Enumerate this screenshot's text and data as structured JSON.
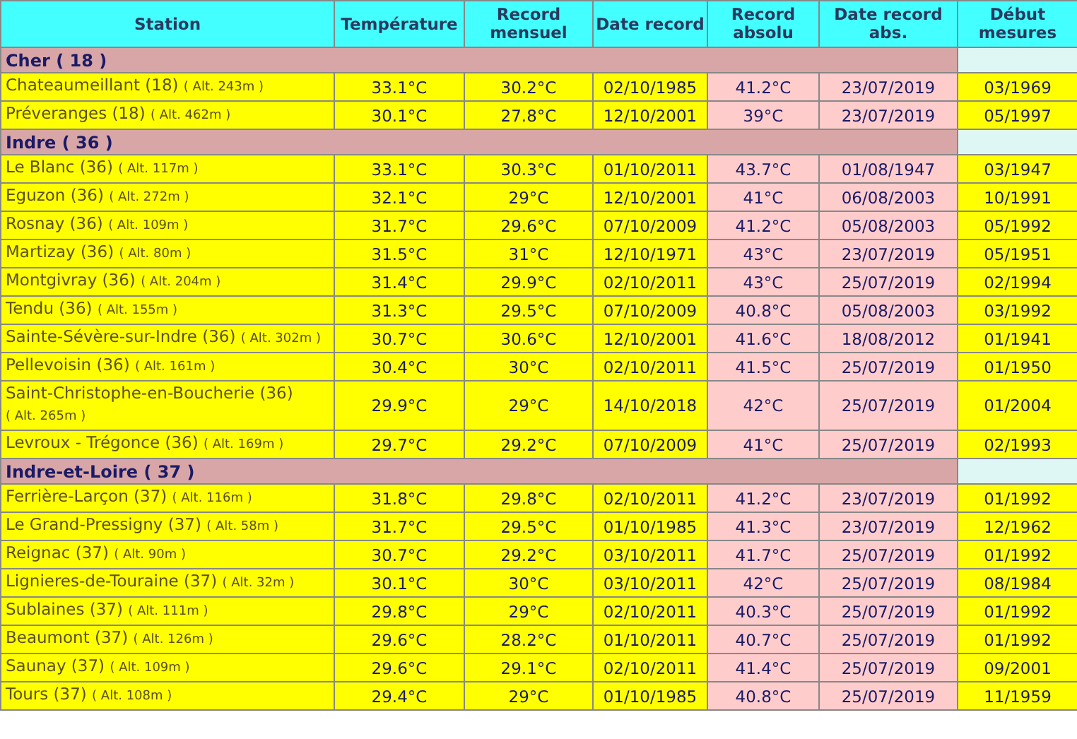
{
  "columns": [
    "Station",
    "Température",
    "Record mensuel",
    "Date record",
    "Record absolu",
    "Date record abs.",
    "Début mesures"
  ],
  "groups": [
    {
      "name": "Cher ( 18 )",
      "rows": [
        {
          "station": "Chateaumeillant (18)",
          "altitude": "( Alt. 243m )",
          "temperature": "33.1°C",
          "record_mensuel": "30.2°C",
          "date_record": "02/10/1985",
          "record_absolu": "41.2°C",
          "date_record_abs": "23/07/2019",
          "debut_mesures": "03/1969"
        },
        {
          "station": "Préveranges (18)",
          "altitude": "( Alt. 462m )",
          "temperature": "30.1°C",
          "record_mensuel": "27.8°C",
          "date_record": "12/10/2001",
          "record_absolu": "39°C",
          "date_record_abs": "23/07/2019",
          "debut_mesures": "05/1997"
        }
      ]
    },
    {
      "name": "Indre ( 36 )",
      "rows": [
        {
          "station": "Le Blanc (36)",
          "altitude": "( Alt. 117m )",
          "temperature": "33.1°C",
          "record_mensuel": "30.3°C",
          "date_record": "01/10/2011",
          "record_absolu": "43.7°C",
          "date_record_abs": "01/08/1947",
          "debut_mesures": "03/1947"
        },
        {
          "station": "Eguzon (36)",
          "altitude": "( Alt. 272m )",
          "temperature": "32.1°C",
          "record_mensuel": "29°C",
          "date_record": "12/10/2001",
          "record_absolu": "41°C",
          "date_record_abs": "06/08/2003",
          "debut_mesures": "10/1991"
        },
        {
          "station": "Rosnay (36)",
          "altitude": "( Alt. 109m )",
          "temperature": "31.7°C",
          "record_mensuel": "29.6°C",
          "date_record": "07/10/2009",
          "record_absolu": "41.2°C",
          "date_record_abs": "05/08/2003",
          "debut_mesures": "05/1992"
        },
        {
          "station": "Martizay (36)",
          "altitude": "( Alt. 80m )",
          "temperature": "31.5°C",
          "record_mensuel": "31°C",
          "date_record": "12/10/1971",
          "record_absolu": "43°C",
          "date_record_abs": "23/07/2019",
          "debut_mesures": "05/1951"
        },
        {
          "station": "Montgivray (36)",
          "altitude": "( Alt. 204m )",
          "temperature": "31.4°C",
          "record_mensuel": "29.9°C",
          "date_record": "02/10/2011",
          "record_absolu": "43°C",
          "date_record_abs": "25/07/2019",
          "debut_mesures": "02/1994"
        },
        {
          "station": "Tendu (36)",
          "altitude": "( Alt. 155m )",
          "temperature": "31.3°C",
          "record_mensuel": "29.5°C",
          "date_record": "07/10/2009",
          "record_absolu": "40.8°C",
          "date_record_abs": "05/08/2003",
          "debut_mesures": "03/1992"
        },
        {
          "station": "Sainte-Sévère-sur-Indre (36)",
          "altitude": "( Alt. 302m )",
          "temperature": "30.7°C",
          "record_mensuel": "30.6°C",
          "date_record": "12/10/2001",
          "record_absolu": "41.6°C",
          "date_record_abs": "18/08/2012",
          "debut_mesures": "01/1941"
        },
        {
          "station": "Pellevoisin (36)",
          "altitude": "( Alt. 161m )",
          "temperature": "30.4°C",
          "record_mensuel": "30°C",
          "date_record": "02/10/2011",
          "record_absolu": "41.5°C",
          "date_record_abs": "25/07/2019",
          "debut_mesures": "01/1950"
        },
        {
          "station": "Saint-Christophe-en-Boucherie (36)",
          "altitude": "( Alt. 265m )",
          "temperature": "29.9°C",
          "record_mensuel": "29°C",
          "date_record": "14/10/2018",
          "record_absolu": "42°C",
          "date_record_abs": "25/07/2019",
          "debut_mesures": "01/2004"
        },
        {
          "station": "Levroux - Trégonce (36)",
          "altitude": "( Alt. 169m )",
          "temperature": "29.7°C",
          "record_mensuel": "29.2°C",
          "date_record": "07/10/2009",
          "record_absolu": "41°C",
          "date_record_abs": "25/07/2019",
          "debut_mesures": "02/1993"
        }
      ]
    },
    {
      "name": "Indre-et-Loire ( 37 )",
      "rows": [
        {
          "station": "Ferrière-Larçon (37)",
          "altitude": "( Alt. 116m )",
          "temperature": "31.8°C",
          "record_mensuel": "29.8°C",
          "date_record": "02/10/2011",
          "record_absolu": "41.2°C",
          "date_record_abs": "23/07/2019",
          "debut_mesures": "01/1992"
        },
        {
          "station": "Le Grand-Pressigny (37)",
          "altitude": "( Alt. 58m )",
          "temperature": "31.7°C",
          "record_mensuel": "29.5°C",
          "date_record": "01/10/1985",
          "record_absolu": "41.3°C",
          "date_record_abs": "23/07/2019",
          "debut_mesures": "12/1962"
        },
        {
          "station": "Reignac (37)",
          "altitude": "( Alt. 90m )",
          "temperature": "30.7°C",
          "record_mensuel": "29.2°C",
          "date_record": "03/10/2011",
          "record_absolu": "41.7°C",
          "date_record_abs": "25/07/2019",
          "debut_mesures": "01/1992"
        },
        {
          "station": "Lignieres-de-Touraine (37)",
          "altitude": "( Alt. 32m )",
          "temperature": "30.1°C",
          "record_mensuel": "30°C",
          "date_record": "03/10/2011",
          "record_absolu": "42°C",
          "date_record_abs": "25/07/2019",
          "debut_mesures": "08/1984"
        },
        {
          "station": "Sublaines (37)",
          "altitude": "( Alt. 111m )",
          "temperature": "29.8°C",
          "record_mensuel": "29°C",
          "date_record": "02/10/2011",
          "record_absolu": "40.3°C",
          "date_record_abs": "25/07/2019",
          "debut_mesures": "01/1992"
        },
        {
          "station": "Beaumont (37)",
          "altitude": "( Alt. 126m )",
          "temperature": "29.6°C",
          "record_mensuel": "28.2°C",
          "date_record": "01/10/2011",
          "record_absolu": "40.7°C",
          "date_record_abs": "25/07/2019",
          "debut_mesures": "01/1992"
        },
        {
          "station": "Saunay (37)",
          "altitude": "( Alt. 109m )",
          "temperature": "29.6°C",
          "record_mensuel": "29.1°C",
          "date_record": "02/10/2011",
          "record_absolu": "41.4°C",
          "date_record_abs": "25/07/2019",
          "debut_mesures": "09/2001"
        },
        {
          "station": "Tours (37)",
          "altitude": "( Alt. 108m )",
          "temperature": "29.4°C",
          "record_mensuel": "29°C",
          "date_record": "01/10/1985",
          "record_absolu": "40.8°C",
          "date_record_abs": "25/07/2019",
          "debut_mesures": "11/1959"
        }
      ]
    }
  ]
}
